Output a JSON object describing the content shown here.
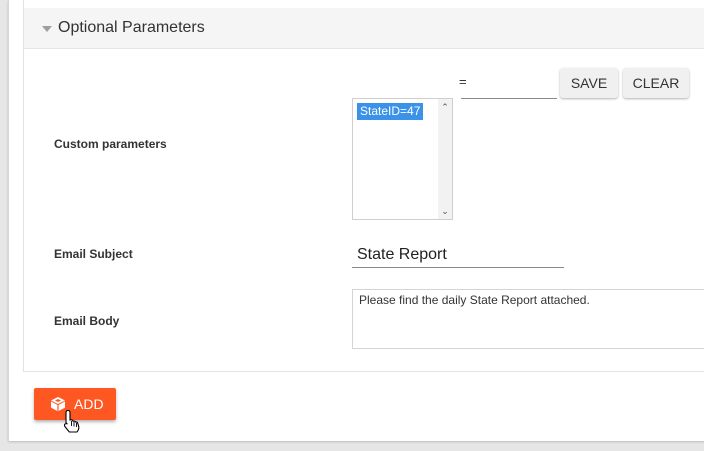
{
  "section": {
    "title": "Optional Parameters"
  },
  "custom_params": {
    "label": "Custom parameters",
    "name_value": "",
    "equals": "=",
    "value_value": "",
    "save_label": "SAVE",
    "clear_label": "CLEAR",
    "items": [
      "StateID=47"
    ],
    "scroll_up_glyph": "⌃",
    "scroll_down_glyph": "⌄"
  },
  "email_subject": {
    "label": "Email Subject",
    "value": "State Report"
  },
  "email_body": {
    "label": "Email Body",
    "value": "Please find the daily State Report attached."
  },
  "actions": {
    "add_label": "ADD"
  },
  "colors": {
    "accent": "#ff5722",
    "selection": "#3a93e8"
  },
  "icons": {
    "section_toggle": "caret-down-icon",
    "add": "cube-icon",
    "pointer": "hand-pointer-icon"
  }
}
